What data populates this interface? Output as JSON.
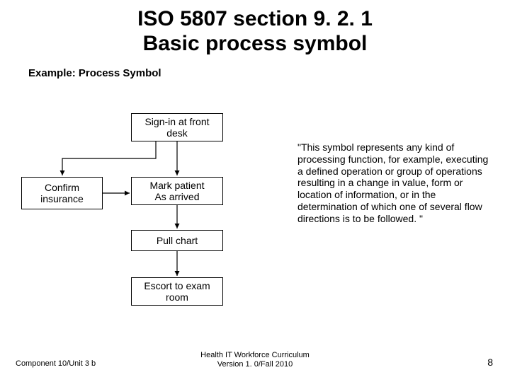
{
  "title_line1": "ISO 5807 section 9. 2. 1",
  "title_line2": "Basic process symbol",
  "subtitle": "Example: Process Symbol",
  "boxes": {
    "signin": "Sign-in at front\ndesk",
    "confirm": "Confirm\ninsurance",
    "mark": "Mark patient\nAs arrived",
    "pull": "Pull chart",
    "escort": "Escort to exam\nroom"
  },
  "quote": "\"This symbol represents any kind of processing function, for example, executing a defined operation or group of operations resulting in a change in value, form or location of information, or in the determination of which one of several flow directions is to be followed. \"",
  "footer_left": "Component 10/Unit 3 b",
  "footer_center_line1": "Health IT Workforce Curriculum",
  "footer_center_line2": "Version 1. 0/Fall 2010",
  "page_number": "8"
}
